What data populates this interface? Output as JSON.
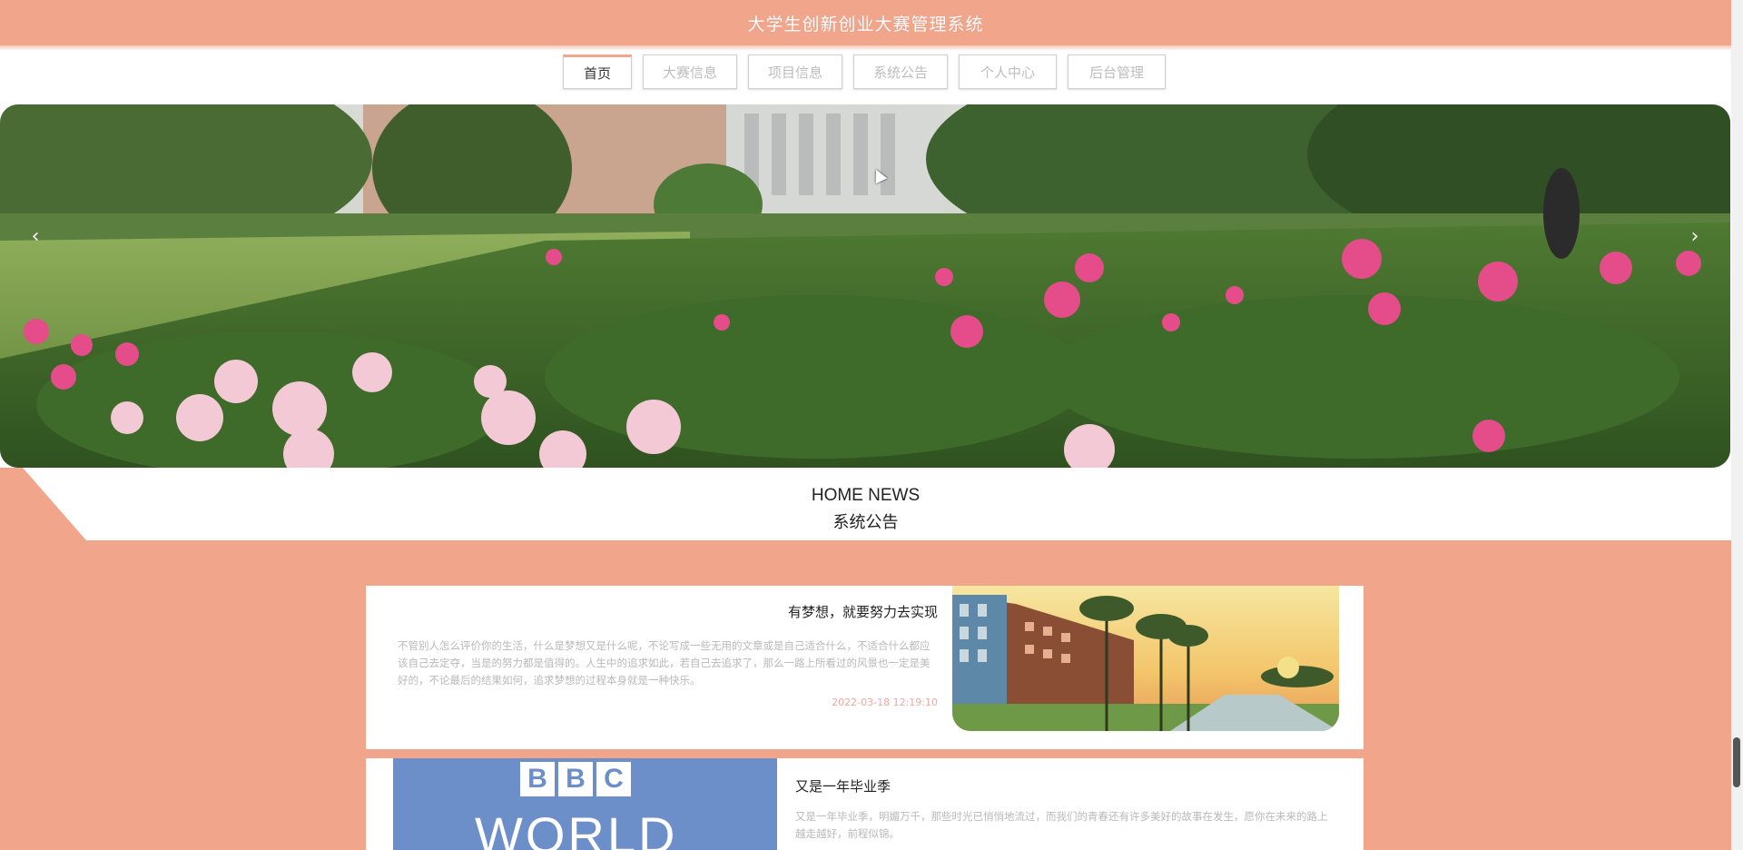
{
  "header": {
    "title": "大学生创新创业大赛管理系统"
  },
  "nav": {
    "items": [
      {
        "label": "首页",
        "active": true
      },
      {
        "label": "大赛信息",
        "active": false
      },
      {
        "label": "项目信息",
        "active": false
      },
      {
        "label": "系统公告",
        "active": false
      },
      {
        "label": "个人中心",
        "active": false
      },
      {
        "label": "后台管理",
        "active": false
      }
    ]
  },
  "banner": {
    "prev_icon": "chevron-left-icon",
    "next_icon": "chevron-right-icon",
    "prev_glyph": "‹",
    "next_glyph": "›"
  },
  "news": {
    "heading_en": "HOME NEWS",
    "heading_cn": "系统公告",
    "items": [
      {
        "title": "有梦想，就要努力去实现",
        "summary": "不管别人怎么评价你的生活，什么是梦想又是什么呢，不论写成一些无用的文章或是自己适合什么，不适合什么都应该自己去定夺，当是的努力都是值得的。人生中的追求如此，若自己去追求了，那么一路上所看过的风景也一定是美好的，不论最后的结果如何，追求梦想的过程本身就是一种快乐。",
        "date": "2022-03-18 12:19:10"
      },
      {
        "title": "又是一年毕业季",
        "summary": "又是一年毕业季，明媚万千，那些时光已悄悄地流过，而我们的青春还有许多美好的故事在发生，愿你在未来的路上越走越好，前程似锦。",
        "date": ""
      }
    ]
  },
  "colors": {
    "accent": "#f1a68c",
    "date": "#f3a6a0"
  }
}
